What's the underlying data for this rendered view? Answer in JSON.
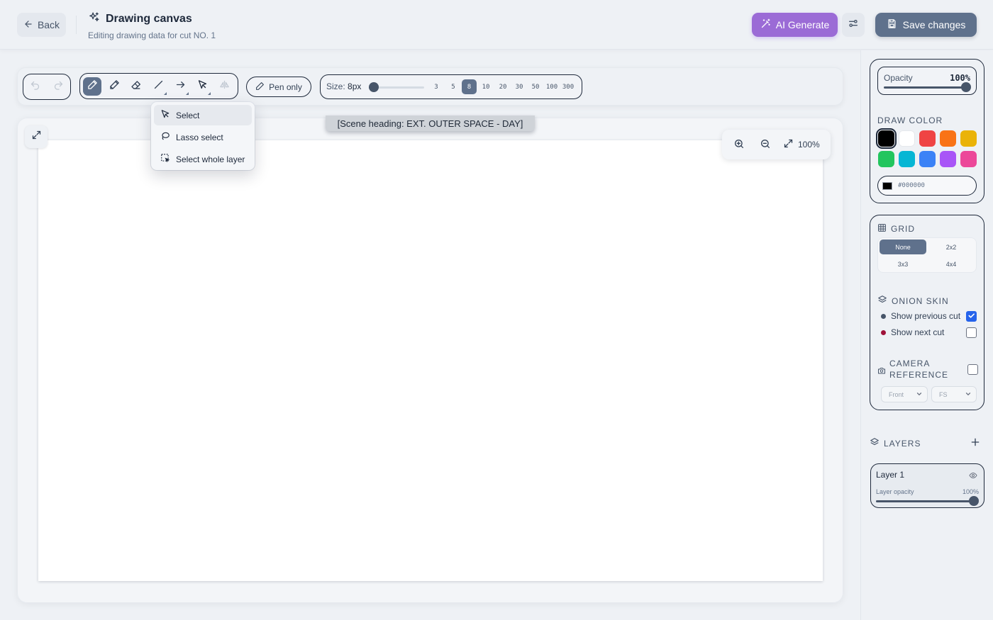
{
  "header": {
    "back_label": "Back",
    "title": "Drawing canvas",
    "subtitle": "Editing drawing data for cut NO. 1",
    "ai_label": "AI Generate",
    "save_label": "Save changes"
  },
  "toolbar": {
    "pen_only_label": "Pen only",
    "size_prefix": "Size:",
    "size_value": "8px",
    "size_presets": [
      "3",
      "5",
      "8",
      "10",
      "20",
      "30",
      "50",
      "100",
      "300"
    ],
    "active_preset": "8"
  },
  "select_menu": {
    "items": [
      "Select",
      "Lasso select",
      "Select whole layer"
    ]
  },
  "canvas": {
    "scene_heading": "[Scene heading: EXT. OUTER SPACE - DAY]",
    "zoom_label": "100%"
  },
  "panel": {
    "opacity_label": "Opacity",
    "opacity_value": "100%",
    "opacity_fraction": 1.0,
    "draw_color_title": "DRAW COLOR",
    "palette": [
      "#000000",
      "#ffffff",
      "#ef4444",
      "#f97316",
      "#eab308",
      "#22c55e",
      "#06b6d4",
      "#3b82f6",
      "#a855f7",
      "#ec4899"
    ],
    "hex_value": "#000000",
    "grid_title": "GRID",
    "grid_options": [
      "None",
      "2x2",
      "3x3",
      "4x4"
    ],
    "grid_selected": "None",
    "onion_title": "ONION SKIN",
    "show_previous": "Show previous cut",
    "show_next": "Show next cut",
    "previous_color": "#475569",
    "next_color": "#9f1239",
    "camera_title_1": "CAMERA",
    "camera_title_2": "REFERENCE",
    "camera_select_1": "Front",
    "camera_select_2": "FS",
    "layers_title": "LAYERS",
    "layer_name": "Layer 1",
    "layer_opacity_label": "Layer opacity",
    "layer_opacity_value": "100%",
    "layer_opacity_fraction": 1.0
  }
}
